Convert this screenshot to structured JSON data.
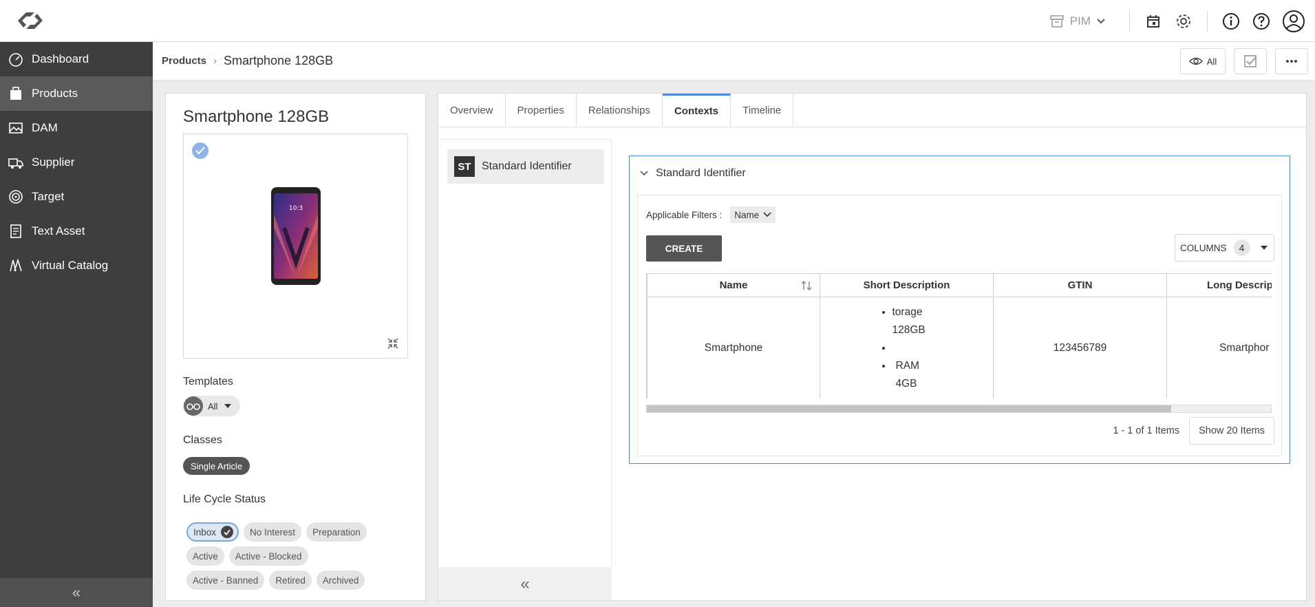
{
  "topbar": {
    "module_label": "PIM",
    "icons": [
      "calendar-icon",
      "gear-icon",
      "info-icon",
      "help-icon",
      "user-icon"
    ]
  },
  "sidebar": {
    "items": [
      {
        "label": "Dashboard",
        "icon": "dashboard-icon"
      },
      {
        "label": "Products",
        "icon": "products-icon",
        "active": true
      },
      {
        "label": "DAM",
        "icon": "image-icon"
      },
      {
        "label": "Supplier",
        "icon": "truck-icon"
      },
      {
        "label": "Target",
        "icon": "target-icon"
      },
      {
        "label": "Text Asset",
        "icon": "text-document-icon"
      },
      {
        "label": "Virtual Catalog",
        "icon": "catalog-icon"
      }
    ]
  },
  "breadcrumb": {
    "parent": "Products",
    "separator": "›",
    "current": "Smartphone 128GB"
  },
  "actions": {
    "view_label": "All"
  },
  "product": {
    "title": "Smartphone 128GB",
    "templates_label": "Templates",
    "template_value": "All",
    "classes_label": "Classes",
    "class_value": "Single Article",
    "lifecycle_label": "Life Cycle Status",
    "lifecycle_rows": [
      [
        {
          "label": "Inbox",
          "selected": true
        },
        {
          "label": "No Interest"
        },
        {
          "label": "Preparation"
        }
      ],
      [
        {
          "label": "Active"
        },
        {
          "label": "Active - Blocked"
        }
      ],
      [
        {
          "label": "Active - Banned"
        },
        {
          "label": "Retired"
        },
        {
          "label": "Archived"
        }
      ]
    ]
  },
  "tabs": [
    "Overview",
    "Properties",
    "Relationships",
    "Contexts",
    "Timeline"
  ],
  "active_tab": "Contexts",
  "contexts": {
    "items": [
      {
        "badge": "ST",
        "label": "Standard Identifier"
      }
    ],
    "panel": {
      "title": "Standard Identifier",
      "filters_label": "Applicable Filters :",
      "filter_value": "Name",
      "create_label": "CREATE",
      "columns_label": "COLUMNS",
      "columns_count": "4",
      "table": {
        "headers": [
          "Name",
          "Short Description",
          "GTIN",
          "Long Descrip"
        ],
        "rows": [
          {
            "name": "Smartphone",
            "short_description": [
              "torage 128GB",
              "",
              "RAM 4GB"
            ],
            "gtin": "123456789",
            "long_description": "Smartphor"
          }
        ]
      },
      "pager_text": "1 - 1 of 1 Items",
      "show_label": "Show 20 Items"
    }
  },
  "colors": {
    "sidebar_bg": "#3e3e3e",
    "accent": "#4a88db",
    "create_button": "#555555"
  }
}
